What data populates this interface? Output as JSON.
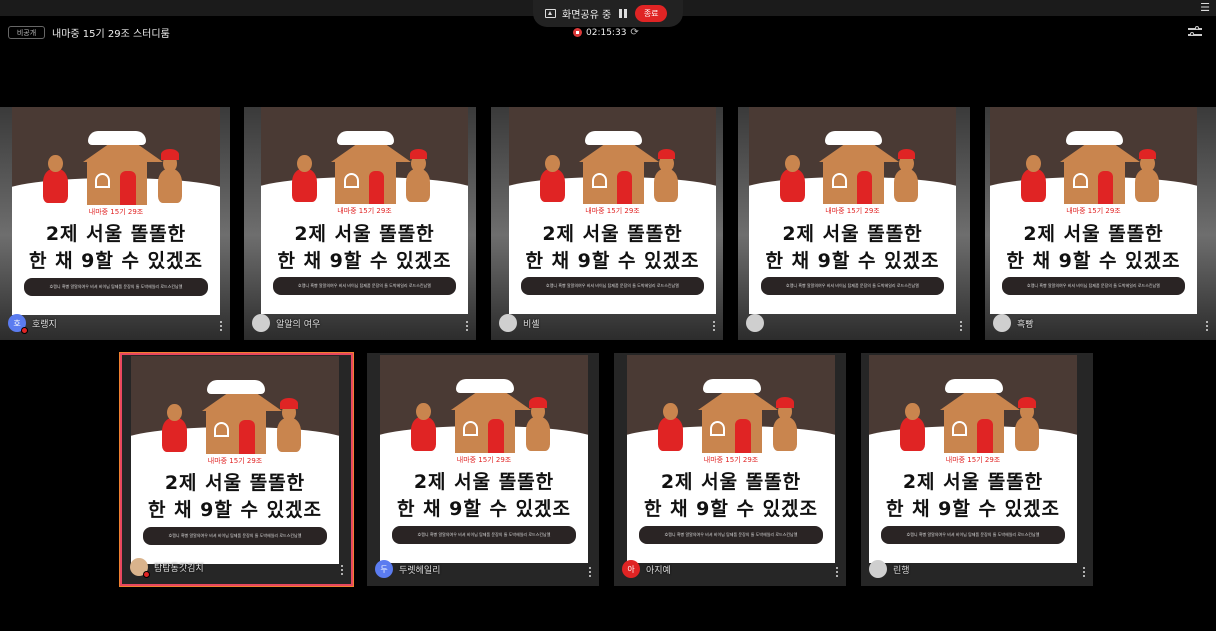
{
  "topbar": {
    "share_status": "화면공유 중",
    "end_label": "종료",
    "private_badge": "비공개",
    "room_title": "내마중 15기 29조 스터디룸",
    "timer": "02:15:33"
  },
  "poster": {
    "subtitle": "내마중 15기 29조",
    "line1": "2제 서울 똘똘한",
    "line2": "한 채 9할 수 있겠조",
    "members": "호랭니 흑빵 알알의여우 비셔 비이님 탐제품 문장의 둘 도박헤일리 로드스킨남엘"
  },
  "participants": [
    {
      "name": "호랭지",
      "avatar_text": "호",
      "avatar_color": "#5b7cf0"
    },
    {
      "name": "알알의 여우",
      "avatar_text": "",
      "avatar_color": "#cfcfcf"
    },
    {
      "name": "비셸",
      "avatar_text": "",
      "avatar_color": "#cfcfcf"
    },
    {
      "name": "",
      "avatar_text": "",
      "avatar_color": "#cfcfcf"
    },
    {
      "name": "흑빵",
      "avatar_text": "",
      "avatar_color": "#cfcfcf"
    },
    {
      "name": "탐탐동갓김치",
      "avatar_text": "",
      "avatar_color": "#d9b38c"
    },
    {
      "name": "두렛헤일리",
      "avatar_text": "두",
      "avatar_color": "#5b7cf0"
    },
    {
      "name": "아지예",
      "avatar_text": "아",
      "avatar_color": "#e02424"
    },
    {
      "name": "린행",
      "avatar_text": "",
      "avatar_color": "#cfcfcf"
    }
  ],
  "colors": {
    "accent_red": "#e02424",
    "poster_brown": "#4a3a34",
    "gingerbread": "#c9854e"
  }
}
